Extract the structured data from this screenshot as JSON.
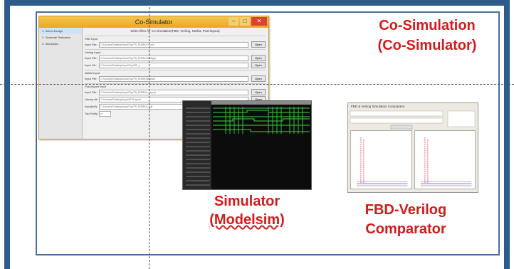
{
  "labels": {
    "cosim_line1": "Co-Simulation",
    "cosim_line2": "(Co-Simulator)",
    "sim_line1": "Simulator",
    "sim_line2": "(Modelsim)",
    "comp_line1": "FBD-Verilog",
    "comp_line2": "Comparator"
  },
  "colors": {
    "accent_red": "#d31b1b",
    "frame_blue": "#2e5c8a"
  },
  "cosim_window": {
    "title": "Co-Simulator",
    "btn_min": "–",
    "btn_max": "□",
    "btn_close": "✕",
    "header": "Select files for Co-simulation(FBD, Verilog, Netlist, Post-layout)",
    "sidebar": [
      "1. Select Design",
      "2. Generate Testcases",
      "3. Simulation"
    ],
    "groups": [
      {
        "title": "FBD Input",
        "rows": [
          {
            "label": "Input File:",
            "value": "C:/Users/x/Desktop/Input/Top/TS_RO/BK/Cx.xml",
            "button": "Open"
          }
        ]
      },
      {
        "title": "Verilog Input",
        "rows": [
          {
            "label": "Input File:",
            "value": "C:/Users/x/Desktop/Input/Top/TS_RO/BK/Verilog/x",
            "button": "Open"
          },
          {
            "label": "Input Lib:",
            "value": "C:/Users/x/Desktop/Input/Top/SIT_x",
            "button": "Open"
          }
        ]
      },
      {
        "title": "Netlist Input",
        "rows": [
          {
            "label": "Input File:",
            "value": "C:/Users/x/Desktop/Input/Top/TS_RO/BK/Netlist/x",
            "button": "Open"
          }
        ]
      },
      {
        "title": "Post-layout Input",
        "rows": [
          {
            "label": "Input File:",
            "value": "C:/Users/x/Desktop/Input/Top/TS_RO/BK/x_layout",
            "button": "Open"
          },
          {
            "label": "Library dir:",
            "value": "C:/Users/x/Desktop/Input/SIT/Layout",
            "button": "Open"
          },
          {
            "label": "Input(sdf):",
            "value": "C:/Users/x/Desktop/Input/Top/TS_RO/BK/x_sdf",
            "button": "Open"
          },
          {
            "label": "Top Entity:",
            "value": "ct",
            "button": ""
          }
        ]
      }
    ]
  },
  "comparator_window": {
    "title": "FBD & Verilog Simulation Comparator"
  }
}
